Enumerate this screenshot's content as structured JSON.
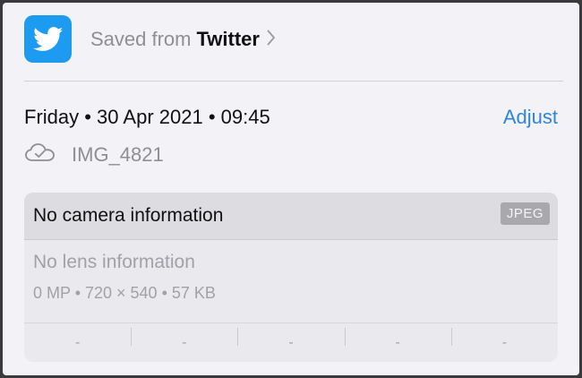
{
  "source": {
    "prefix": "Saved from",
    "app": "Twitter",
    "icon": "twitter-bird-icon",
    "brand_color": "#1d9bf0"
  },
  "date": {
    "text": "Friday • 30 Apr 2021 • 09:45",
    "adjust_label": "Adjust",
    "accent_color": "#2f86d9"
  },
  "file": {
    "icon": "icloud-check-icon",
    "name": "IMG_4821"
  },
  "camera_info": {
    "title": "No camera information",
    "format_badge": "JPEG",
    "lens": "No lens information",
    "specs": "0 MP  •  720 × 540  •  57 KB",
    "exif": [
      "-",
      "-",
      "-",
      "-",
      "-"
    ]
  }
}
